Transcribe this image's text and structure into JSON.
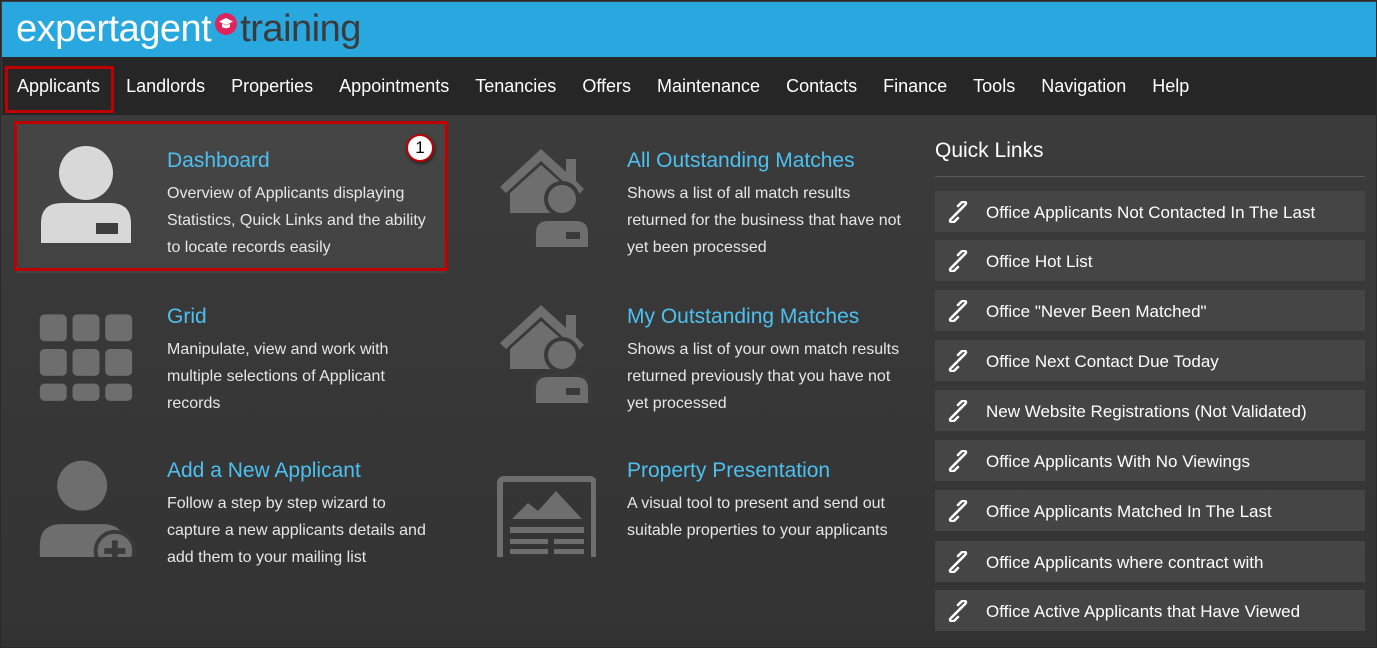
{
  "brand": {
    "part1": "expert",
    "part2": "agent",
    "part3": "training"
  },
  "nav": [
    "Applicants",
    "Landlords",
    "Properties",
    "Appointments",
    "Tenancies",
    "Offers",
    "Maintenance",
    "Contacts",
    "Finance",
    "Tools",
    "Navigation",
    "Help"
  ],
  "tiles": {
    "dashboard": {
      "title": "Dashboard",
      "desc": "Overview of Applicants displaying Statistics, Quick Links and the ability to locate records easily"
    },
    "all_matches": {
      "title": "All Outstanding Matches",
      "desc": "Shows a list of all match results returned for the business that have not yet been processed"
    },
    "grid": {
      "title": "Grid",
      "desc": "Manipulate, view and work with multiple selections of Applicant records"
    },
    "my_matches": {
      "title": "My Outstanding Matches",
      "desc": "Shows a list of your own match results returned previously that you have not yet processed"
    },
    "add_applicant": {
      "title": "Add a New Applicant",
      "desc": "Follow a step by step wizard to capture a new applicants details and add them to your mailing list"
    },
    "presentation": {
      "title": "Property Presentation",
      "desc": "A visual tool to present and send out suitable properties to your applicants"
    }
  },
  "callout": "1",
  "quick_links": {
    "title": "Quick Links",
    "items": [
      "Office Applicants Not Contacted In The Last",
      "Office Hot List",
      "Office \"Never Been Matched\"",
      "Office Next Contact Due Today",
      "New Website Registrations (Not Validated)",
      "Office Applicants With No Viewings",
      "Office Applicants Matched In The Last",
      "Office Applicants where contract with",
      "Office Active Applicants that Have Viewed"
    ]
  },
  "colors": {
    "brand_blue": "#29a8e0",
    "link_blue": "#4dc0f0",
    "highlight_red": "#c00000",
    "logo_cap": "#e0245e"
  }
}
